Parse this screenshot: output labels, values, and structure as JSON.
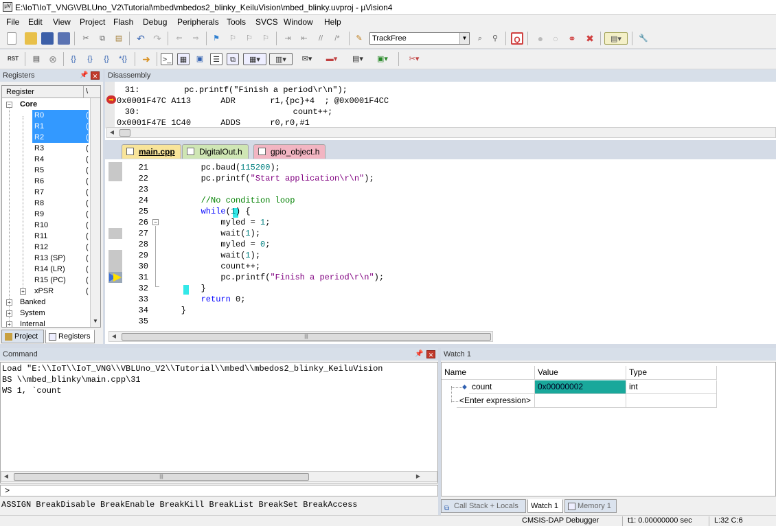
{
  "window": {
    "title": "E:\\IoT\\IoT_VNG\\VBLUno_V2\\Tutorial\\mbed\\mbedos2_blinky_KeiluVision\\mbed_blinky.uvproj - µVision4"
  },
  "menu": [
    "File",
    "Edit",
    "View",
    "Project",
    "Flash",
    "Debug",
    "Peripherals",
    "Tools",
    "SVCS",
    "Window",
    "Help"
  ],
  "toolbar": {
    "target_combo": "TrackFree",
    "rst_label": "RST"
  },
  "registers": {
    "title": "Registers",
    "header": "Register",
    "core_label": "Core",
    "items": [
      "R0",
      "R1",
      "R2",
      "R3",
      "R4",
      "R5",
      "R6",
      "R7",
      "R8",
      "R9",
      "R10",
      "R11",
      "R12",
      "R13 (SP)",
      "R14 (LR)",
      "R15 (PC)",
      "xPSR"
    ],
    "groups": [
      "Banked",
      "System",
      "Internal"
    ],
    "tabs": [
      "Project",
      "Registers"
    ]
  },
  "disassembly": {
    "title": "Disassembly",
    "lines": [
      "    31:         pc.printf(\"Finish a period\\r\\n\");",
      "0x0001F47C A113      ADR       r1,{pc}+4  ; @0x0001F4CC",
      "    30:                               count++;",
      "0x0001F47E 1C40      ADDS      r0,r0,#1"
    ]
  },
  "editor": {
    "tabs": [
      "main.cpp",
      "DigitalOut.h",
      "gpio_object.h"
    ],
    "line_numbers": [
      "21",
      "22",
      "23",
      "24",
      "25",
      "26",
      "27",
      "28",
      "29",
      "30",
      "31",
      "32",
      "33",
      "34",
      "35"
    ],
    "code": [
      "        pc.baud(115200);",
      "        pc.printf(\"Start application\\r\\n\");",
      "",
      "        //No condition loop",
      "        while(1) {",
      "            myled = 1;",
      "            wait(1);",
      "            myled = 0;",
      "            wait(1);",
      "            count++;",
      "            pc.printf(\"Finish a period\\r\\n\");",
      "        }",
      "        return 0;",
      "    }",
      ""
    ]
  },
  "command": {
    "title": "Command",
    "lines": [
      "Load \"E:\\\\IoT\\\\IoT_VNG\\\\VBLUno_V2\\\\Tutorial\\\\mbed\\\\mbedos2_blinky_KeiluVision",
      "BS \\\\mbed_blinky\\main.cpp\\31",
      "WS 1, `count"
    ],
    "prompt": ">",
    "hint": "ASSIGN BreakDisable BreakEnable BreakKill BreakList BreakSet BreakAccess"
  },
  "watch": {
    "title": "Watch 1",
    "columns": [
      "Name",
      "Value",
      "Type"
    ],
    "rows": [
      {
        "name": "count",
        "value": "0x00000002",
        "type": "int"
      }
    ],
    "enter_expression": "<Enter expression>",
    "tabs": [
      "Call Stack + Locals",
      "Watch 1",
      "Memory 1"
    ]
  },
  "status": {
    "debugger": "CMSIS-DAP Debugger",
    "time": "t1: 0.00000000 sec",
    "position": "L:32 C:6"
  },
  "colors": {
    "selection": "#3399ff",
    "watch_value_bg": "#19a89b"
  }
}
